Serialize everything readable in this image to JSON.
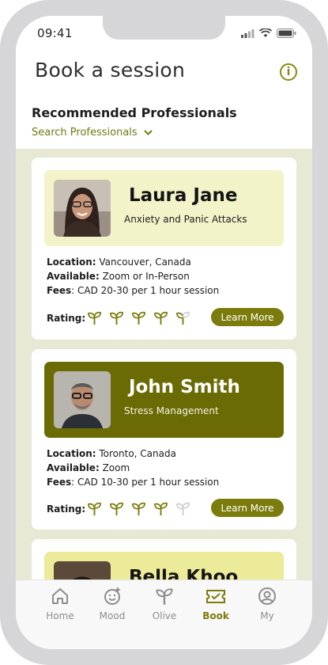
{
  "status_bar": {
    "time": "09:41"
  },
  "header": {
    "title": "Book a session",
    "section_title": "Recommended Professionals",
    "search_label": "Search Professionals"
  },
  "professionals": [
    {
      "name": "Laura Jane",
      "specialty": "Anxiety and Panic Attacks",
      "location_label": "Location:",
      "location": "Vancouver, Canada",
      "available_label": "Available:",
      "available": "Zoom or In-Person",
      "fees_label": "Fees",
      "fees": ": CAD 20-30 per 1 hour session",
      "rating_label": "Rating:",
      "rating": 4.5,
      "button": "Learn More"
    },
    {
      "name": "John Smith",
      "specialty": "Stress Management",
      "location_label": "Location:",
      "location": "Toronto, Canada",
      "available_label": "Available:",
      "available": "Zoom",
      "fees_label": "Fees",
      "fees": ": CAD 10-30 per 1 hour session",
      "rating_label": "Rating:",
      "rating": 4,
      "button": "Learn More"
    },
    {
      "name": "Bella Khoo"
    }
  ],
  "tabs": [
    {
      "label": "Home",
      "icon": "home-icon"
    },
    {
      "label": "Mood",
      "icon": "mood-icon"
    },
    {
      "label": "Olive",
      "icon": "sprout-icon"
    },
    {
      "label": "Book",
      "icon": "ticket-icon",
      "active": true
    },
    {
      "label": "My",
      "icon": "profile-icon"
    }
  ],
  "colors": {
    "accent": "#7b7c0c",
    "card_highlight_light": "#f2f3c8",
    "card_highlight_dark": "#6b6b05",
    "background": "#e8e9d5"
  }
}
